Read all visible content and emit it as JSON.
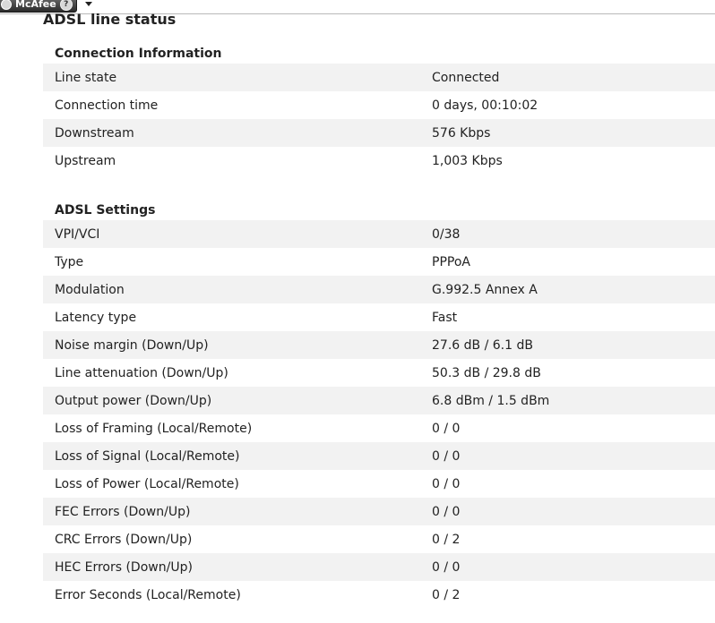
{
  "toolbar": {
    "brand": "McAfee",
    "help_symbol": "?"
  },
  "page": {
    "title": "ADSL line status"
  },
  "connection_information": {
    "heading": "Connection Information",
    "rows": [
      {
        "label": "Line state",
        "value": "Connected"
      },
      {
        "label": "Connection time",
        "value": "0 days, 00:10:02"
      },
      {
        "label": "Downstream",
        "value": "576 Kbps"
      },
      {
        "label": "Upstream",
        "value": "1,003 Kbps"
      }
    ]
  },
  "adsl_settings": {
    "heading": "ADSL Settings",
    "rows": [
      {
        "label": "VPI/VCI",
        "value": "0/38"
      },
      {
        "label": "Type",
        "value": "PPPoA"
      },
      {
        "label": "Modulation",
        "value": "G.992.5 Annex A"
      },
      {
        "label": "Latency type",
        "value": "Fast"
      },
      {
        "label": "Noise margin (Down/Up)",
        "value": "27.6 dB / 6.1 dB"
      },
      {
        "label": "Line attenuation (Down/Up)",
        "value": "50.3 dB / 29.8 dB"
      },
      {
        "label": "Output power (Down/Up)",
        "value": "6.8 dBm / 1.5 dBm"
      },
      {
        "label": "Loss of Framing (Local/Remote)",
        "value": "0 / 0"
      },
      {
        "label": "Loss of Signal (Local/Remote)",
        "value": "0 / 0"
      },
      {
        "label": "Loss of Power (Local/Remote)",
        "value": "0 / 0"
      },
      {
        "label": "FEC Errors (Down/Up)",
        "value": "0 / 0"
      },
      {
        "label": "CRC Errors (Down/Up)",
        "value": "0 / 2"
      },
      {
        "label": "HEC Errors (Down/Up)",
        "value": "0 / 0"
      },
      {
        "label": "Error Seconds (Local/Remote)",
        "value": "0 / 2"
      }
    ]
  },
  "icons": {
    "brand_logo": "mcafee-logo-icon",
    "help": "help-icon",
    "menu": "dropdown-arrow-icon"
  }
}
